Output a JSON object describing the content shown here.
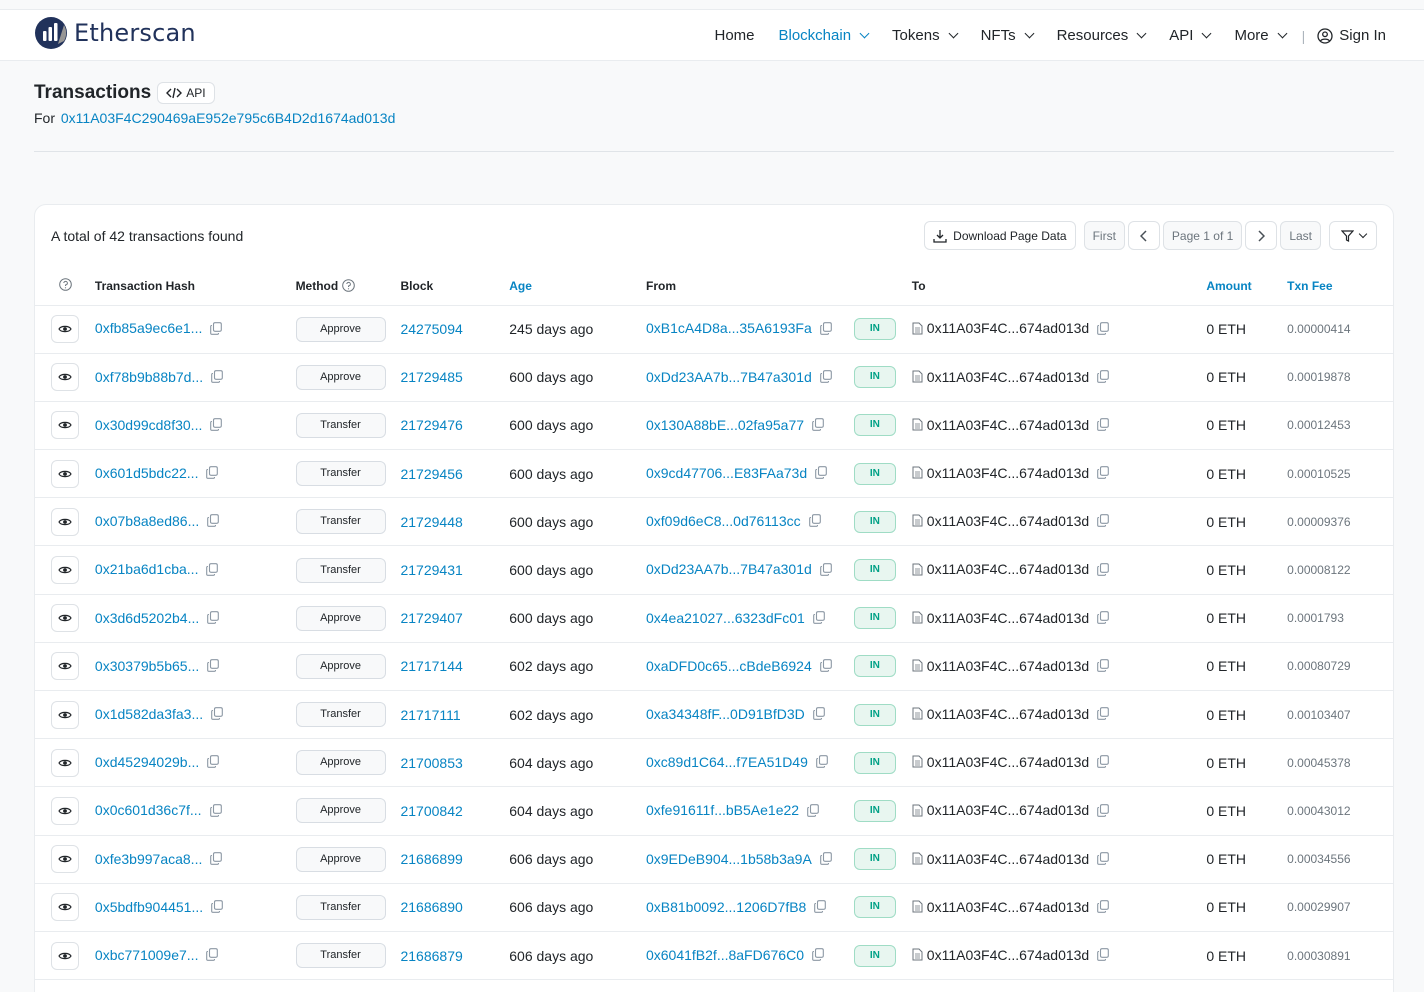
{
  "brand": {
    "name": "Etherscan"
  },
  "nav": {
    "items": [
      {
        "label": "Home",
        "dropdown": false,
        "active": false
      },
      {
        "label": "Blockchain",
        "dropdown": true,
        "active": true
      },
      {
        "label": "Tokens",
        "dropdown": true,
        "active": false
      },
      {
        "label": "NFTs",
        "dropdown": true,
        "active": false
      },
      {
        "label": "Resources",
        "dropdown": true,
        "active": false
      },
      {
        "label": "API",
        "dropdown": true,
        "active": false
      },
      {
        "label": "More",
        "dropdown": true,
        "active": false
      }
    ],
    "separator": "|",
    "signin": "Sign In"
  },
  "header": {
    "title": "Transactions",
    "api_label": "API",
    "for_label": "For",
    "address": "0x11A03F4C290469aE952e795c6B4D2d1674ad013d"
  },
  "card": {
    "total": "A total of 42 transactions found",
    "download": "Download Page Data",
    "first": "First",
    "page": "Page 1 of 1",
    "last": "Last"
  },
  "columns": {
    "hash": "Transaction Hash",
    "method": "Method",
    "block": "Block",
    "age": "Age",
    "from": "From",
    "to": "To",
    "amount": "Amount",
    "fee": "Txn Fee"
  },
  "rows": [
    {
      "hash": "0xfb85a9ec6e1...",
      "method": "Approve",
      "block": "24275094",
      "age": "245 days ago",
      "from": "0xB1cA4D8a...35A6193Fa",
      "dir": "IN",
      "to": "0x11A03F4C...674ad013d",
      "amount": "0 ETH",
      "fee": "0.00000414"
    },
    {
      "hash": "0xf78b9b88b7d...",
      "method": "Approve",
      "block": "21729485",
      "age": "600 days ago",
      "from": "0xDd23AA7b...7B47a301d",
      "dir": "IN",
      "to": "0x11A03F4C...674ad013d",
      "amount": "0 ETH",
      "fee": "0.00019878"
    },
    {
      "hash": "0x30d99cd8f30...",
      "method": "Transfer",
      "block": "21729476",
      "age": "600 days ago",
      "from": "0x130A88bE...02fa95a77",
      "dir": "IN",
      "to": "0x11A03F4C...674ad013d",
      "amount": "0 ETH",
      "fee": "0.00012453"
    },
    {
      "hash": "0x601d5bdc22...",
      "method": "Transfer",
      "block": "21729456",
      "age": "600 days ago",
      "from": "0x9cd47706...E83FAa73d",
      "dir": "IN",
      "to": "0x11A03F4C...674ad013d",
      "amount": "0 ETH",
      "fee": "0.00010525"
    },
    {
      "hash": "0x07b8a8ed86...",
      "method": "Transfer",
      "block": "21729448",
      "age": "600 days ago",
      "from": "0xf09d6eC8...0d76113cc",
      "dir": "IN",
      "to": "0x11A03F4C...674ad013d",
      "amount": "0 ETH",
      "fee": "0.00009376"
    },
    {
      "hash": "0x21ba6d1cba...",
      "method": "Transfer",
      "block": "21729431",
      "age": "600 days ago",
      "from": "0xDd23AA7b...7B47a301d",
      "dir": "IN",
      "to": "0x11A03F4C...674ad013d",
      "amount": "0 ETH",
      "fee": "0.00008122"
    },
    {
      "hash": "0x3d6d5202b4...",
      "method": "Approve",
      "block": "21729407",
      "age": "600 days ago",
      "from": "0x4ea21027...6323dFc01",
      "dir": "IN",
      "to": "0x11A03F4C...674ad013d",
      "amount": "0 ETH",
      "fee": "0.0001793"
    },
    {
      "hash": "0x30379b5b65...",
      "method": "Approve",
      "block": "21717144",
      "age": "602 days ago",
      "from": "0xaDFD0c65...cBdeB6924",
      "dir": "IN",
      "to": "0x11A03F4C...674ad013d",
      "amount": "0 ETH",
      "fee": "0.00080729"
    },
    {
      "hash": "0x1d582da3fa3...",
      "method": "Transfer",
      "block": "21717111",
      "age": "602 days ago",
      "from": "0xa34348fF...0D91BfD3D",
      "dir": "IN",
      "to": "0x11A03F4C...674ad013d",
      "amount": "0 ETH",
      "fee": "0.00103407"
    },
    {
      "hash": "0xd45294029b...",
      "method": "Approve",
      "block": "21700853",
      "age": "604 days ago",
      "from": "0xc89d1C64...f7EA51D49",
      "dir": "IN",
      "to": "0x11A03F4C...674ad013d",
      "amount": "0 ETH",
      "fee": "0.00045378"
    },
    {
      "hash": "0x0c601d36c7f...",
      "method": "Approve",
      "block": "21700842",
      "age": "604 days ago",
      "from": "0xfe91611f...bB5Ae1e22",
      "dir": "IN",
      "to": "0x11A03F4C...674ad013d",
      "amount": "0 ETH",
      "fee": "0.00043012"
    },
    {
      "hash": "0xfe3b997aca8...",
      "method": "Approve",
      "block": "21686899",
      "age": "606 days ago",
      "from": "0x9EDeB904...1b58b3a9A",
      "dir": "IN",
      "to": "0x11A03F4C...674ad013d",
      "amount": "0 ETH",
      "fee": "0.00034556"
    },
    {
      "hash": "0x5bdfb904451...",
      "method": "Transfer",
      "block": "21686890",
      "age": "606 days ago",
      "from": "0xB81b0092...1206D7fB8",
      "dir": "IN",
      "to": "0x11A03F4C...674ad013d",
      "amount": "0 ETH",
      "fee": "0.00029907"
    },
    {
      "hash": "0xbc771009e7...",
      "method": "Transfer",
      "block": "21686879",
      "age": "606 days ago",
      "from": "0x6041fB2f...8aFD676C0",
      "dir": "IN",
      "to": "0x11A03F4C...674ad013d",
      "amount": "0 ETH",
      "fee": "0.00030891"
    }
  ]
}
